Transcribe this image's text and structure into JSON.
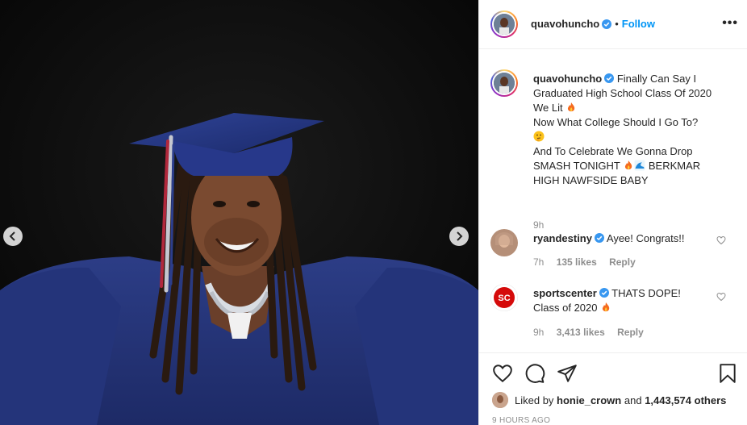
{
  "post": {
    "author": "quavohuncho",
    "follow_label": "Follow",
    "dot": "•",
    "more_label": "•••"
  },
  "caption": {
    "author": "quavohuncho",
    "line1": "Finally Can Say I Graduated High School Class Of 2020 We Lit",
    "line2": "Now What College Should I Go To?",
    "line3a": "And To Celebrate We Gonna Drop SMASH TONIGHT",
    "line3b": "BERKMAR HIGH NAWFSIDE BABY",
    "time": "9h"
  },
  "comments": [
    {
      "author": "ryandestiny",
      "text": "Ayee! Congrats!!",
      "time": "7h",
      "likes": "135 likes",
      "reply": "Reply"
    },
    {
      "author": "sportscenter",
      "text_a": "THATS DOPE!",
      "text_b": "Class of 2020",
      "time": "9h",
      "likes": "3,413 likes",
      "reply": "Reply"
    }
  ],
  "likes": {
    "prefix": "Liked by",
    "user": "honie_crown",
    "joiner": "and",
    "count": "1,443,574 others"
  },
  "timestamp": "9 HOURS AGO",
  "colors": {
    "follow": "#0095f6",
    "verified": "#3897f0",
    "fire": "#f56b1f",
    "espn_red": "#d50a0a"
  },
  "icons": [
    "heart-icon",
    "comment-icon",
    "share-icon",
    "bookmark-icon",
    "chevron-left-icon",
    "chevron-right-icon",
    "more-icon",
    "verified-icon"
  ]
}
